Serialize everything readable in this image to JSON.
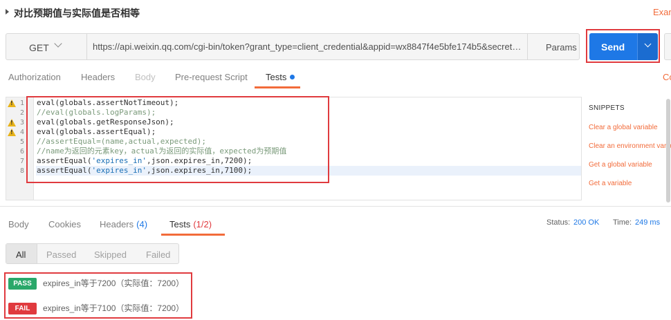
{
  "request": {
    "name": "对比预期值与实际值是否相等",
    "examples_link": "Exan",
    "method": "GET",
    "url": "https://api.weixin.qq.com/cgi-bin/token?grant_type=client_credential&appid=wx8847f4e5bfe174b5&secret=...",
    "params_label": "Params",
    "send_label": "Send"
  },
  "request_tabs": {
    "authorization": "Authorization",
    "headers": "Headers",
    "body": "Body",
    "prerequest": "Pre-request Script",
    "tests": "Tests",
    "cookies_stub": "Co"
  },
  "editor": {
    "lines": [
      {
        "num": "1",
        "warning": true,
        "text": "eval(globals.assertNotTimeout);",
        "comment": false
      },
      {
        "num": "2",
        "warning": false,
        "text": "//eval(globals.logParams);",
        "comment": true
      },
      {
        "num": "3",
        "warning": true,
        "text": "eval(globals.getResponseJson);",
        "comment": false
      },
      {
        "num": "4",
        "warning": true,
        "text": "eval(globals.assertEqual);",
        "comment": false
      },
      {
        "num": "5",
        "warning": false,
        "text": "//assertEqual=(name,actual,expected);",
        "comment": true
      },
      {
        "num": "6",
        "warning": false,
        "text": "//name为返回的元素key，actual为返回的实际值，expected为预期值",
        "comment": true
      },
      {
        "num": "7",
        "warning": false,
        "pre": "assertEqual(",
        "str": "'expires_in'",
        "post": ",json.expires_in,7200);",
        "comment": false
      },
      {
        "num": "8",
        "warning": false,
        "pre": "assertEqual(",
        "str": "'expires_in'",
        "post": ",json.expires_in,7100);",
        "comment": false
      }
    ]
  },
  "snippets": {
    "title": "SNIPPETS",
    "items": [
      "Clear a global variable",
      "Clear an environment varia",
      "Get a global variable",
      "Get a variable"
    ]
  },
  "response_tabs": {
    "body": "Body",
    "cookies": "Cookies",
    "headers": "Headers",
    "headers_count": "(4)",
    "tests": "Tests",
    "tests_count": "(1/2)",
    "status_label": "Status:",
    "status_value": "200 OK",
    "time_label": "Time:",
    "time_value": "249 ms"
  },
  "filters": [
    "All",
    "Passed",
    "Skipped",
    "Failed"
  ],
  "results": [
    {
      "badge": "PASS",
      "text": "expires_in等于7200（实际值：7200）"
    },
    {
      "badge": "FAIL",
      "text": "expires_in等于7100（实际值：7200）"
    }
  ],
  "colors": {
    "accent": "#f26b3a",
    "send": "#1e78e6",
    "pass": "#2aa86a",
    "fail": "#e03a3e"
  }
}
